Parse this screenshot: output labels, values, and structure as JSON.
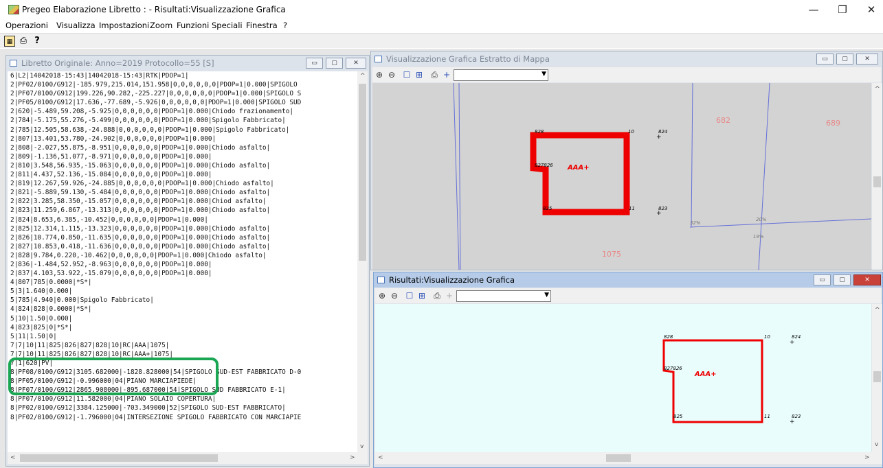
{
  "window": {
    "title": "Pregeo Elaborazione Libretto : - Risultati:Visualizzazione Grafica",
    "controls": [
      "—",
      "❐",
      "✕"
    ]
  },
  "menu": [
    "Operazioni",
    "Visualizza",
    "Impostazioni",
    "Zoom",
    "Funzioni Speciali",
    "Finestra",
    "?"
  ],
  "toolbar": {
    "icons": [
      "grid-table-icon",
      "printer-icon",
      "help-icon"
    ]
  },
  "libretto": {
    "title": "Libretto Originale: Anno=2019 Protocollo=55 [S]",
    "lines": [
      "6|L2|14042018-15:43|14042018-15:43|RTK|PDOP=1|",
      "2|PF02/0100/G912|-185.979,215.014,151.958|0,0,0,0,0,0|PDOP=1|0.000|SPIGOLO ",
      "2|PF07/0100/G912|199.226,90.282,-225.227|0,0,0,0,0,0|PDOP=1|0.000|SPIGOLO S",
      "2|PF05/0100/G912|17.636,-77.689,-5.926|0,0,0,0,0,0|PDOP=1|0.000|SPIGOLO SUD",
      "2|620|-5.489,59.208,-5.925|0,0,0,0,0,0|PDOP=1|0.000|Chiodo frazionamento|",
      "2|784|-5.175,55.276,-5.499|0,0,0,0,0,0|PDOP=1|0.000|Spigolo Fabbricato|",
      "2|785|12.505,58.638,-24.888|0,0,0,0,0,0|PDOP=1|0.000|Spigolo Fabbricato|",
      "2|807|13.401,53.780,-24.902|0,0,0,0,0,0|PDOP=1|0.000|",
      "2|808|-2.027,55.875,-8.951|0,0,0,0,0,0|PDOP=1|0.000|Chiodo asfalto|",
      "2|809|-1.136,51.077,-8.971|0,0,0,0,0,0|PDOP=1|0.000|",
      "2|810|3.548,56.935,-15.063|0,0,0,0,0,0|PDOP=1|0.000|Chiodo asfalto|",
      "2|811|4.437,52.136,-15.084|0,0,0,0,0,0|PDOP=1|0.000|",
      "2|819|12.267,59.926,-24.885|0,0,0,0,0,0|PDOP=1|0.000|Chiodo asfalto|",
      "2|821|-5.889,59.130,-5.484|0,0,0,0,0,0|PDOP=1|0.000|Chiodo asfalto|",
      "2|822|3.285,58.350,-15.057|0,0,0,0,0,0|PDOP=1|0.000|Chiod asfalto|",
      "2|823|11.259,6.867,-13.313|0,0,0,0,0,0|PDOP=1|0.000|Chiodo asfalto|",
      "2|824|8.653,6.385,-10.452|0,0,0,0,0,0|PDOP=1|0.000|",
      "2|825|12.314,1.115,-13.323|0,0,0,0,0,0|PDOP=1|0.000|Chiodo asfalto|",
      "2|826|10.774,0.850,-11.635|0,0,0,0,0,0|PDOP=1|0.000|Chiodo asfalto|",
      "2|827|10.853,0.418,-11.636|0,0,0,0,0,0|PDOP=1|0.000|Chiodo asfalto|",
      "2|828|9.784,0.220,-10.462|0,0,0,0,0,0|PDOP=1|0.000|Chiodo asfalto|",
      "2|836|-1.484,52.952,-8.963|0,0,0,0,0,0|PDOP=1|0.000|",
      "2|837|4.103,53.922,-15.079|0,0,0,0,0,0|PDOP=1|0.000|",
      "4|807|785|0.0000|*S*|",
      "5|3|1.640|0.000|",
      "5|785|4.940|0.000|Spigolo Fabbricato|",
      "4|824|828|0.0000|*S*|",
      "5|10|1.50|0.000|",
      "4|823|825|0|*S*|",
      "5|11|1.50|0|",
      "7|7|10|11|825|826|827|828|10|RC|AAA|1075|",
      "7|7|10|11|825|826|827|828|10|RC|AAA+|1075|",
      "7|1|620|PV|",
      "8|PF08/0100/G912|3105.682000|-1828.828000|54|SPIGOLO SUD-EST FABBRICATO D-0",
      "8|PF05/0100/G912|-0.996000|04|PIANO MARCIAPIEDE|",
      "8|PF07/0100/G912|2865.908000|-895.687000|54|SPIGOLO SUD FABBRICATO E-1|",
      "8|PF07/0100/G912|11.582000|04|PIANO SOLAIO COPERTURA|",
      "8|PF02/0100/G912|3384.125000|-703.349000|52|SPIGOLO SUD-EST FABBRICATO|",
      "8|PF02/0100/G912|-1.796000|04|INTERSEZIONE SPIGOLO FABBRICATO CON MARCIAPIE"
    ]
  },
  "mappa": {
    "title": "Visualizzazione Grafica Estratto di Mappa",
    "parcels": [
      "682",
      "689",
      "1075"
    ],
    "label": "AAA+",
    "points": [
      "828",
      "10",
      "824",
      "827826",
      "825",
      "11",
      "823",
      "32%",
      "20%",
      "19%"
    ]
  },
  "risultati": {
    "title": "Risultati:Visualizzazione Grafica",
    "label": "AAA+",
    "points": [
      "828",
      "10",
      "824",
      "827826",
      "825",
      "11",
      "823"
    ]
  },
  "graph_toolbar_icons": [
    "zoom-in-icon",
    "zoom-out-icon",
    "select-rect-icon",
    "zoom-window-icon",
    "printer-icon",
    "crosshair-icon"
  ]
}
